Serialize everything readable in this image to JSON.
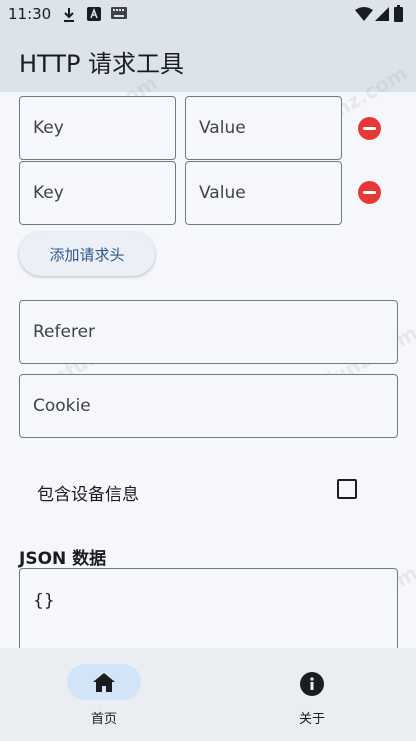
{
  "status_bar": {
    "time": "11:30",
    "icons": [
      "download-icon",
      "a-badge-icon",
      "keyboard-icon",
      "wifi-icon",
      "signal-icon",
      "battery-icon"
    ]
  },
  "app_bar": {
    "title": "HTTP 请求工具"
  },
  "headers": {
    "rows": [
      {
        "key_placeholder": "Key",
        "value_placeholder": "Value"
      },
      {
        "key_placeholder": "Key",
        "value_placeholder": "Value"
      }
    ],
    "add_button_label": "添加请求头"
  },
  "fields": {
    "referer_placeholder": "Referer",
    "cookie_placeholder": "Cookie"
  },
  "device_info": {
    "label": "包含设备信息",
    "checked": false
  },
  "json": {
    "label": "JSON 数据",
    "value": "{}"
  },
  "watermark": "mfunz.com",
  "bottom_nav": {
    "items": [
      {
        "label": "首页",
        "icon": "home-icon",
        "selected": true
      },
      {
        "label": "关于",
        "icon": "info-icon",
        "selected": false
      }
    ]
  },
  "colors": {
    "app_bar_bg": "#dde3ea",
    "remove": "#e53935",
    "nav_selected_pill": "#d3e4f8",
    "add_button_text": "#2e5a8b"
  }
}
